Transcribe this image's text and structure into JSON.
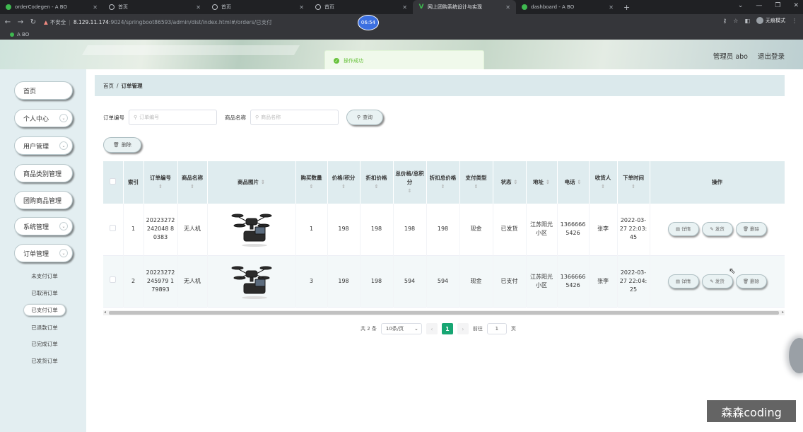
{
  "browser": {
    "tabs": [
      {
        "title": "orderCodegen - A BO",
        "favicon": "green-dot-icon",
        "active": false
      },
      {
        "title": "首页",
        "favicon": "chrome-icon",
        "active": false
      },
      {
        "title": "首页",
        "favicon": "chrome-icon",
        "active": false
      },
      {
        "title": "首页",
        "favicon": "chrome-icon",
        "active": false
      },
      {
        "title": "网上团购系统设计与实现",
        "favicon": "v-icon",
        "active": true
      },
      {
        "title": "dashboard - A BO",
        "favicon": "green-dot-icon",
        "active": false
      }
    ],
    "security_label": "不安全",
    "url_host": "8.129.11.174",
    "url_path": ":9024/springboot86593/admin/dist/index.html#/orders/已支付",
    "incognito_label": "无痕模式",
    "bookmark": "A BO",
    "timer": "06:54"
  },
  "header": {
    "user_label": "管理员 abo",
    "logout": "退出登录"
  },
  "toast": {
    "text": "操作成功"
  },
  "sidebar": {
    "items": [
      {
        "label": "首页",
        "chevron": false
      },
      {
        "label": "个人中心",
        "chevron": true
      },
      {
        "label": "用户管理",
        "chevron": true
      },
      {
        "label": "商品类别管理",
        "chevron": false
      },
      {
        "label": "团购商品管理",
        "chevron": false
      },
      {
        "label": "系统管理",
        "chevron": true
      },
      {
        "label": "订单管理",
        "chevron": true
      }
    ],
    "sub_items": [
      {
        "label": "未支付订单",
        "active": false
      },
      {
        "label": "已取消订单",
        "active": false
      },
      {
        "label": "已支付订单",
        "active": true
      },
      {
        "label": "已退款订单",
        "active": false
      },
      {
        "label": "已完成订单",
        "active": false
      },
      {
        "label": "已发货订单",
        "active": false
      }
    ]
  },
  "breadcrumb": {
    "home": "首页",
    "sep": "/",
    "current": "订单管理"
  },
  "search": {
    "order_no_label": "订单编号",
    "order_no_placeholder": "订单编号",
    "product_label": "商品名称",
    "product_placeholder": "商品名称",
    "query_button": "查询"
  },
  "toolbar": {
    "delete_button": "删除"
  },
  "table": {
    "headers": [
      "索引",
      "订单编号",
      "商品名称",
      "商品图片",
      "购买数量",
      "价格/积分",
      "折扣价格",
      "总价格/总积分",
      "折扣总价格",
      "支付类型",
      "状态",
      "地址",
      "电话",
      "收货人",
      "下单时间",
      "操作"
    ],
    "rows": [
      {
        "index": "1",
        "order_no": "20223272242048 80383",
        "product": "无人机",
        "quantity": "1",
        "price": "198",
        "discount_price": "198",
        "total": "198",
        "discount_total": "198",
        "pay_type": "现金",
        "status": "已发货",
        "address": "江苏阳光小区",
        "phone": "13666665426",
        "receiver": "张李",
        "time": "2022-03-27 22:03:45"
      },
      {
        "index": "2",
        "order_no": "20223272245979 179893",
        "product": "无人机",
        "quantity": "3",
        "price": "198",
        "discount_price": "198",
        "total": "594",
        "discount_total": "594",
        "pay_type": "现金",
        "status": "已支付",
        "address": "江苏阳光小区",
        "phone": "13666665426",
        "receiver": "张李",
        "time": "2022-03-27 22:04:25"
      }
    ],
    "actions": {
      "detail": "详情",
      "ship": "发货",
      "delete": "删除"
    }
  },
  "pagination": {
    "total": "共 2 条",
    "page_size": "10条/页",
    "current_page": "1",
    "goto_label": "前往",
    "goto_value": "1",
    "page_suffix": "页"
  },
  "watermark": "森森coding"
}
